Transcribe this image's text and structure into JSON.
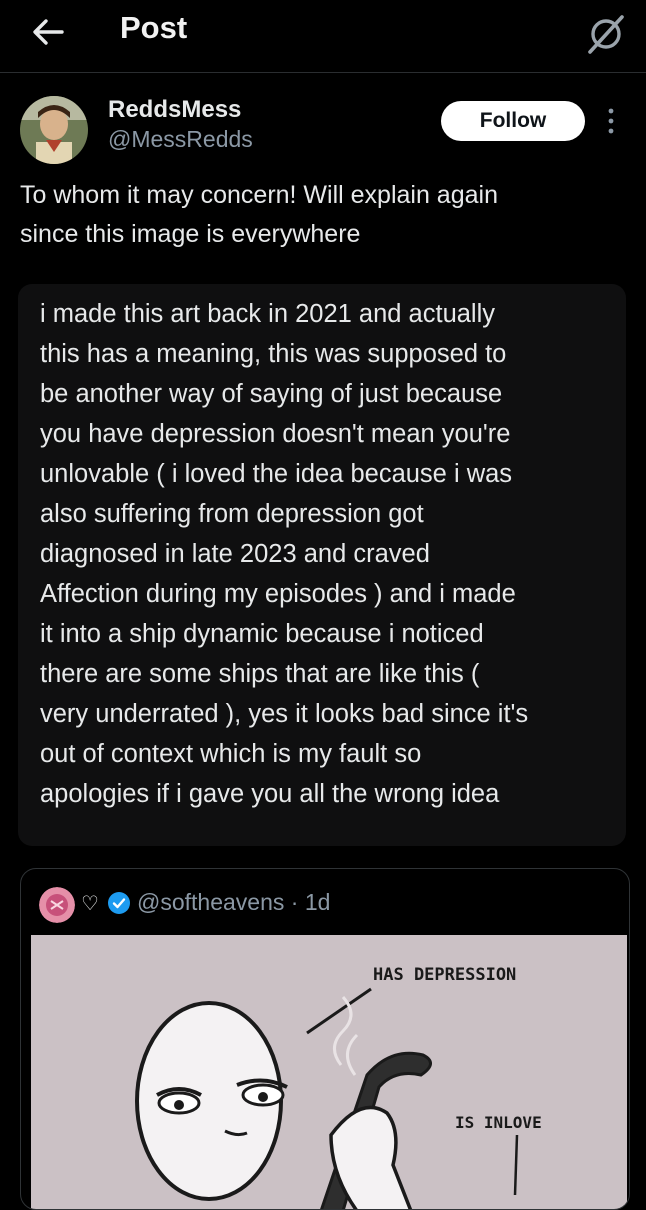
{
  "header": {
    "title": "Post",
    "back_icon": "arrow-left-icon",
    "grok_icon": "grok-icon"
  },
  "author": {
    "name": "ReddsMess",
    "handle": "@MessRedds",
    "follow_label": "Follow"
  },
  "post": {
    "text_lines": [
      "To whom it may concern! Will explain again",
      "since this image is everywhere"
    ]
  },
  "attached_text": {
    "lines": [
      "i made this art back in 2021 and actually",
      "this has a meaning, this was supposed to",
      "be another way of saying of just because",
      "you have depression doesn't mean you're",
      "unlovable ( i loved the idea because i was",
      "also suffering from depression got",
      "diagnosed in late 2023 and craved",
      "Affection during my episodes ) and i made",
      "it into a ship dynamic because i noticed",
      "there are some ships that are like this (",
      "very underrated ), yes it looks bad since it's",
      "out of context which is my fault so",
      "apologies if i gave you all the wrong idea"
    ]
  },
  "quoted": {
    "heart": "♡",
    "handle": "@softheavens",
    "time": "· 1d",
    "image_labels": {
      "top": "HAS DEPRESSION",
      "bottom": "IS INLOVE"
    }
  },
  "colors": {
    "background": "#000000",
    "card": "#0f0f10",
    "muted": "#8b98a5",
    "verified": "#1d9bf0"
  }
}
